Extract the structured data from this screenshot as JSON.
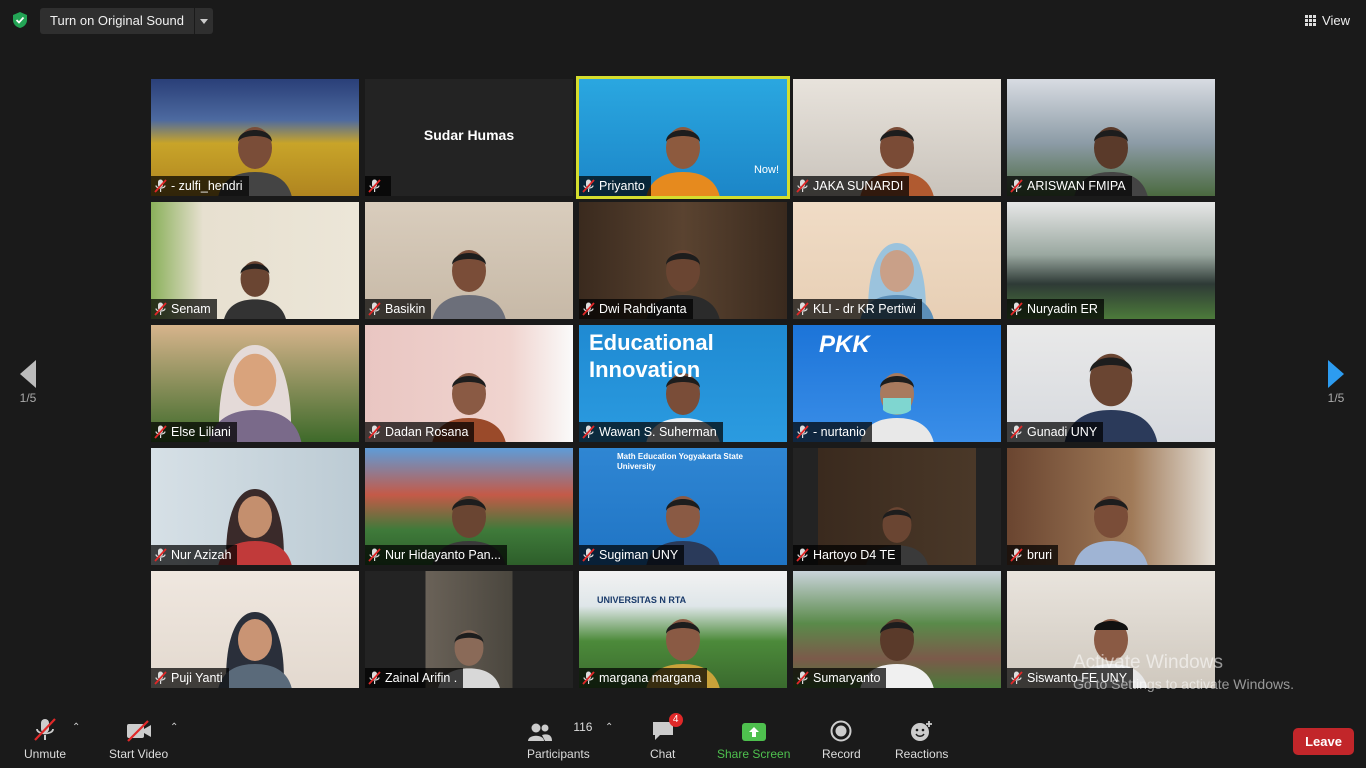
{
  "topbar": {
    "sound_button": "Turn on Original Sound",
    "view_label": "View"
  },
  "nav": {
    "left_page": "1/5",
    "right_page": "1/5"
  },
  "participants": [
    {
      "name": "- zulfi_hendri"
    },
    {
      "name": "",
      "avatar_name": "Sudar Humas"
    },
    {
      "name": "Priyanto",
      "overlay": "Now!"
    },
    {
      "name": "JAKA SUNARDI"
    },
    {
      "name": "ARISWAN FMIPA"
    },
    {
      "name": "Senam"
    },
    {
      "name": "Basikin"
    },
    {
      "name": "Dwi Rahdiyanta"
    },
    {
      "name": "KLI - dr KR Pertiwi"
    },
    {
      "name": "Nuryadin ER"
    },
    {
      "name": "Else Liliani"
    },
    {
      "name": "Dadan Rosana"
    },
    {
      "name": "Wawan S. Suherman",
      "overlay": "Educational Innovation"
    },
    {
      "name": "- nurtanio",
      "overlay": "PKK"
    },
    {
      "name": "Gunadi UNY"
    },
    {
      "name": "Nur Azizah"
    },
    {
      "name": "Nur Hidayanto Pan..."
    },
    {
      "name": "Sugiman UNY",
      "overlay": "Math Education Yogyakarta State University"
    },
    {
      "name": "Hartoyo D4 TE"
    },
    {
      "name": "bruri"
    },
    {
      "name": "Puji Yanti"
    },
    {
      "name": "Zainal Arifin ."
    },
    {
      "name": "margana margana",
      "overlay": "UNIVERSITAS N RTA"
    },
    {
      "name": "Sumaryanto"
    },
    {
      "name": "Siswanto FE UNY"
    }
  ],
  "watermark": {
    "line1": "Activate Windows",
    "line2": "Go to Settings to activate Windows."
  },
  "toolbar": {
    "unmute": "Unmute",
    "start_video": "Start Video",
    "participants": "Participants",
    "participants_count": "116",
    "chat": "Chat",
    "chat_badge": "4",
    "share_screen": "Share Screen",
    "record": "Record",
    "reactions": "Reactions",
    "leave": "Leave"
  },
  "colors": {
    "background": "#1a1a1a",
    "active_speaker": "#d4dd2e",
    "mute_red": "#e02828",
    "share_green": "#4ec04e",
    "leave_red": "#c2262a"
  }
}
